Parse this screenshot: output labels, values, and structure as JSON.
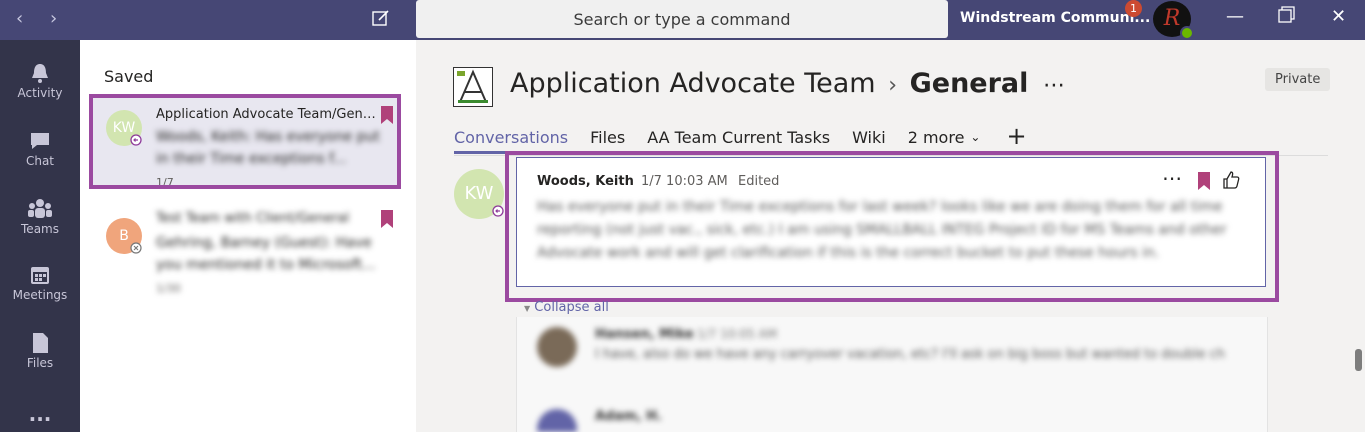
{
  "topbar": {
    "search_placeholder": "Search or type a command",
    "org_name": "Windstream Communi...",
    "notification_count": "1",
    "avatar_initial": "R"
  },
  "rail": {
    "items": [
      {
        "label": "Activity",
        "icon": "bell-icon"
      },
      {
        "label": "Chat",
        "icon": "chat-icon"
      },
      {
        "label": "Teams",
        "icon": "teams-icon"
      },
      {
        "label": "Meetings",
        "icon": "calendar-icon"
      },
      {
        "label": "Files",
        "icon": "file-icon"
      },
      {
        "label": "...",
        "icon": "more-icon"
      }
    ]
  },
  "saved": {
    "title": "Saved",
    "cards": [
      {
        "initials": "KW",
        "title": "Application Advocate Team/Gene...",
        "preview": "Woods, Keith: Has everyone put in their Time exceptions f...",
        "date": "1/7"
      },
      {
        "initials": "B",
        "title": "Test Team with Client/General",
        "preview": "Gehring, Barney (Guest): Have you mentioned it to Microsoft...",
        "date": "1/30"
      }
    ]
  },
  "channel": {
    "team_name": "Application Advocate Team",
    "channel_name": "General",
    "privacy": "Private",
    "tabs": [
      "Conversations",
      "Files",
      "AA Team Current Tasks",
      "Wiki",
      "2 more"
    ],
    "add_tab": "+"
  },
  "message": {
    "initials": "KW",
    "author": "Woods, Keith",
    "time": "1/7 10:03 AM",
    "edited": "Edited",
    "body": "Has everyone put in their Time exceptions for last week? looks like we are doing them for all time reporting (not just vac., sick, etc.) I am using SMALLBALL INTEG Project ID for MS Teams and other Advocate work and will get clarification if this is the correct bucket to put these hours in.",
    "collapse_label": "Collapse all"
  },
  "replies": [
    {
      "author": "Hansen, Mike",
      "time": "1/7 10:05 AM",
      "body": "I have, also do we have any carryover vacation, etc? I'll ask on big boss but wanted to double check."
    },
    {
      "author": "Adam, H.",
      "time": "",
      "body": ""
    }
  ],
  "colors": {
    "topbar": "#464775",
    "rail": "#33344a",
    "accent": "#6264a7",
    "highlight": "#9b4aa0",
    "bookmark": "#b0417a"
  }
}
